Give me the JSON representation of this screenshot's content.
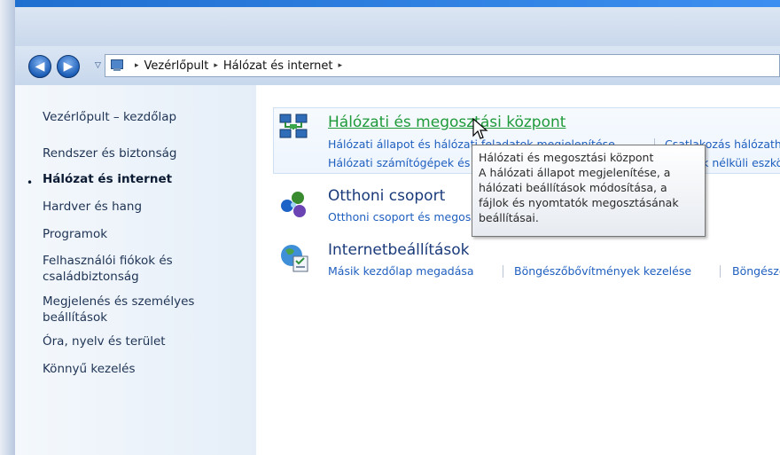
{
  "navigation": {
    "back_glyph": "◀",
    "forward_glyph": "▶",
    "recent_glyph": "▽"
  },
  "address": {
    "icon": "control-panel-icon",
    "separator": "▸",
    "crumbs": [
      "Vezérlőpult",
      "Hálózat és internet"
    ]
  },
  "sidebar": {
    "home": "Vezérlőpult – kezdőlap",
    "bullet": "•",
    "items": [
      "Rendszer és biztonság",
      "Hálózat és internet",
      "Hardver és hang",
      "Programok",
      "Felhasználói fiókok és",
      "családbiztonság",
      "Megjelenés és személyes",
      "beállítások",
      "Óra, nyelv és terület",
      "Könnyű kezelés"
    ],
    "active_index": 1
  },
  "categories": [
    {
      "title": "Hálózati és megosztási központ",
      "icon": "network-sharing-icon",
      "links": [
        "Hálózati állapot és hálózati feladatok megjelenítése",
        "Csatlakozás hálózathoz",
        "Hálózati számítógépek és eszközök megtekintése",
        "Vezeték nélküli eszköz hozzáadása a hálózathoz"
      ],
      "hovered": true
    },
    {
      "title": "Otthoni csoport",
      "icon": "homegroup-icon",
      "links": [
        "Otthoni csoport és megosztási beállítások választása"
      ]
    },
    {
      "title": "Internetbeállítások",
      "icon": "internet-options-icon",
      "links": [
        "Másik kezdőlap megadása",
        "Böngészőbővítmények kezelése",
        "Böngészési előzmények és cookie-k törlése"
      ]
    }
  ],
  "tooltip": {
    "lines": [
      "Hálózati és megosztási központ",
      "A hálózati állapot megjelenítése, a",
      "hálózati beállítások módosítása, a",
      "fájlok és nyomtatók megosztásának",
      "beállításai."
    ]
  },
  "colors": {
    "link": "#1f5fbf",
    "title": "#1a3a7a",
    "hover_title": "#1f9a3a",
    "sidebar_text": "#1e3354"
  }
}
